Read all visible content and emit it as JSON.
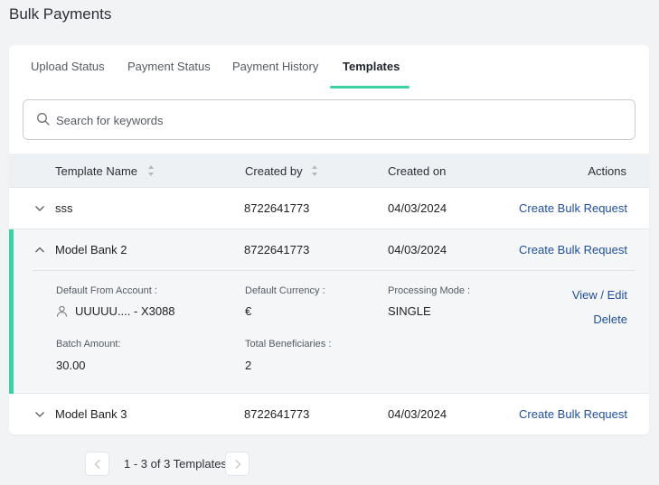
{
  "page": {
    "title": "Bulk Payments"
  },
  "tabs": [
    {
      "label": "Upload Status",
      "active": false
    },
    {
      "label": "Payment Status",
      "active": false
    },
    {
      "label": "Payment History",
      "active": false
    },
    {
      "label": "Templates",
      "active": true
    }
  ],
  "search": {
    "placeholder": "Search for keywords",
    "value": ""
  },
  "table": {
    "headers": {
      "template_name": "Template Name",
      "created_by": "Created by",
      "created_on": "Created on",
      "actions": "Actions"
    },
    "rows": [
      {
        "name": "sss",
        "created_by": "8722641773",
        "created_on": "04/03/2024",
        "action": "Create Bulk Request",
        "expanded": false
      },
      {
        "name": "Model Bank 2",
        "created_by": "8722641773",
        "created_on": "04/03/2024",
        "action": "Create Bulk Request",
        "expanded": true
      },
      {
        "name": "Model Bank 3",
        "created_by": "8722641773",
        "created_on": "04/03/2024",
        "action": "Create Bulk Request",
        "expanded": false
      }
    ],
    "details": {
      "default_from_account_label": "Default From Account :",
      "default_from_account_value": "UUUUU.... - X3088",
      "default_currency_label": "Default Currency :",
      "default_currency_value": "€",
      "processing_mode_label": "Processing Mode :",
      "processing_mode_value": "SINGLE",
      "batch_amount_label": "Batch Amount:",
      "batch_amount_value": "30.00",
      "total_beneficiaries_label": "Total Beneficiaries :",
      "total_beneficiaries_value": "2",
      "view_edit_label": "View / Edit",
      "delete_label": "Delete"
    }
  },
  "pagination": {
    "text": "1 - 3 of 3 Templates"
  },
  "colors": {
    "accent": "#3fd1a6",
    "link": "#1f4f9a",
    "header_bg": "#eef1f4",
    "expanded_bg": "#f4f6f8"
  }
}
